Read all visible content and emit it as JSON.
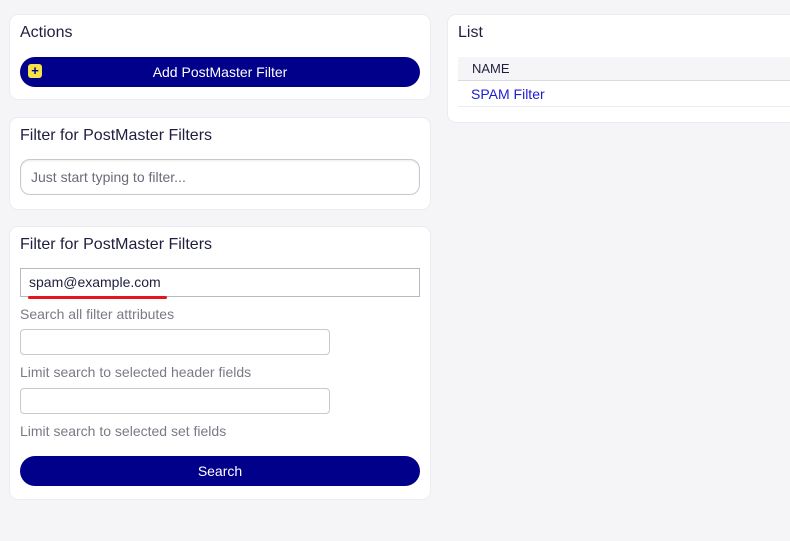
{
  "actions": {
    "title": "Actions",
    "add_button_label": "Add PostMaster Filter",
    "add_icon_glyph": "+",
    "add_icon": "plus-square-icon",
    "icon_color": "#f5e34b"
  },
  "quick_filter": {
    "title": "Filter for PostMaster Filters",
    "placeholder": "Just start typing to filter..."
  },
  "search_filter": {
    "title": "Filter for PostMaster Filters",
    "value": "spam@example.com",
    "search_all_label": "Search all filter attributes",
    "header_fields_label": "Limit search to selected header fields",
    "set_fields_label": "Limit search to selected set fields",
    "search_button_label": "Search"
  },
  "list": {
    "title": "List",
    "columns": [
      "NAME"
    ],
    "rows": [
      {
        "name": "SPAM Filter"
      }
    ]
  },
  "colors": {
    "primary": "#00008b",
    "link": "#1c1cd0",
    "highlight_underline": "#e8141b",
    "background": "#f5f5f7"
  }
}
